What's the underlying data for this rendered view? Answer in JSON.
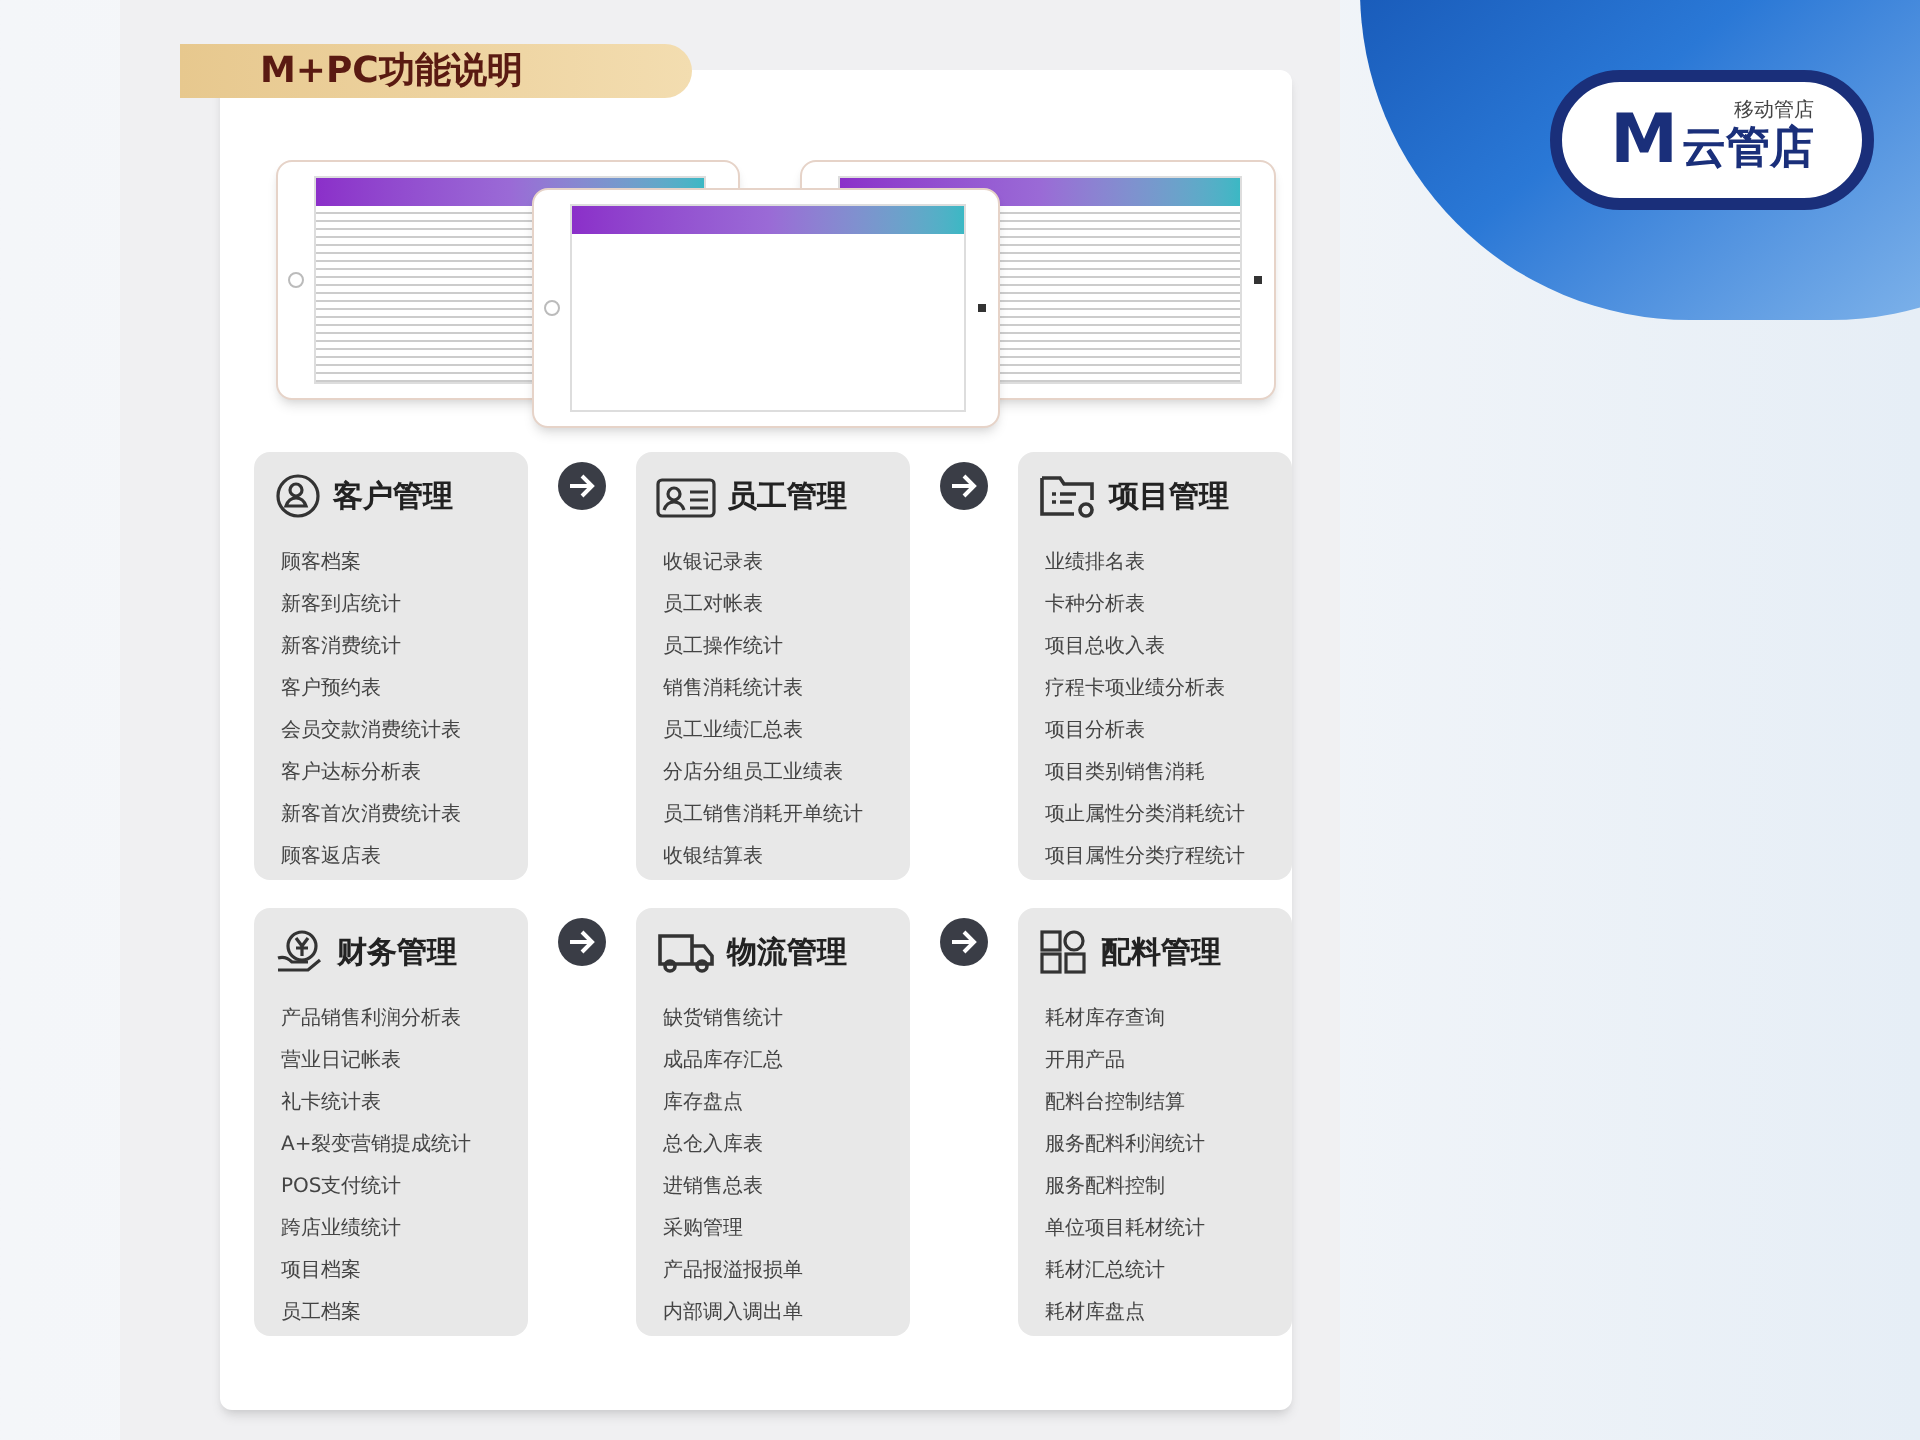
{
  "header": {
    "title": "M+PC功能说明"
  },
  "logo": {
    "mark": "M",
    "tagline": "移动管店",
    "name": "云管店"
  },
  "panels": [
    {
      "kind": "customer",
      "title": "客户管理",
      "items": [
        "顾客档案",
        "新客到店统计",
        "新客消费统计",
        "客户预约表",
        "会员交款消费统计表",
        "客户达标分析表",
        "新客首次消费统计表",
        "顾客返店表"
      ]
    },
    {
      "kind": "staff",
      "title": "员工管理",
      "items": [
        "收银记录表",
        "员工对帐表",
        "员工操作统计",
        "销售消耗统计表",
        "员工业绩汇总表",
        "分店分组员工业绩表",
        "员工销售消耗开单统计",
        "收银结算表"
      ]
    },
    {
      "kind": "project",
      "title": "项目管理",
      "items": [
        "业绩排名表",
        "卡种分析表",
        "项目总收入表",
        "疗程卡项业绩分析表",
        "项目分析表",
        "项目类别销售消耗",
        "项止属性分类消耗统计",
        "项目属性分类疗程统计"
      ]
    },
    {
      "kind": "finance",
      "title": "财务管理",
      "items": [
        "产品销售利润分析表",
        "营业日记帐表",
        "礼卡统计表",
        "A+裂变营销提成统计",
        "POS支付统计",
        "跨店业绩统计",
        "项目档案",
        "员工档案"
      ]
    },
    {
      "kind": "logistics",
      "title": "物流管理",
      "items": [
        "缺货销售统计",
        "成品库存汇总",
        "库存盘点",
        "总仓入库表",
        "进销售总表",
        "采购管理",
        "产品报溢报损单",
        "内部调入调出单"
      ]
    },
    {
      "kind": "materials",
      "title": "配料管理",
      "items": [
        "耗材库存查询",
        "开用产品",
        "配料台控制结算",
        "服务配料利润统计",
        "服务配料控制",
        "单位项目耗材统计",
        "耗材汇总统计",
        "耗材库盘点"
      ]
    }
  ]
}
